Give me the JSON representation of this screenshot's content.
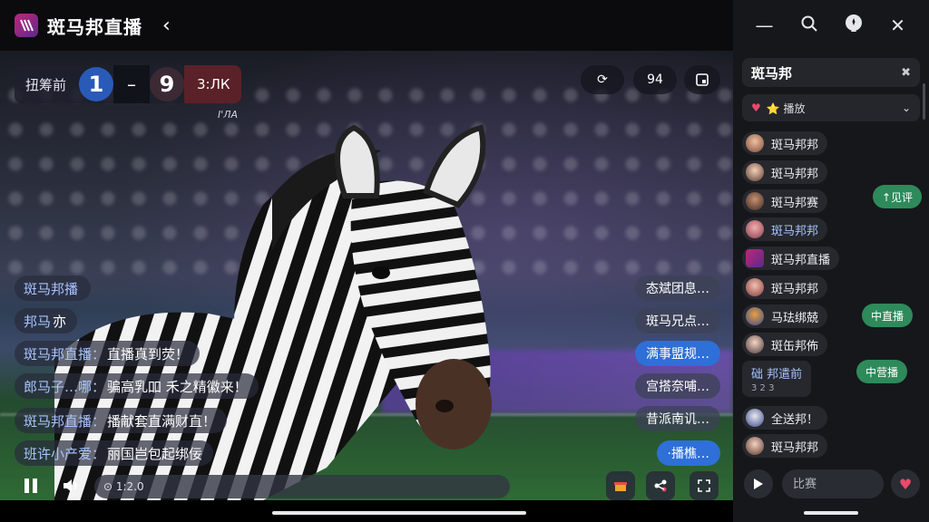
{
  "app": {
    "title": "斑马邦直播",
    "logo_icon": "zebra-logo-icon",
    "back_icon": "chevron-left-icon"
  },
  "scoreboard": {
    "home_team": "扭筹前",
    "home_score": "1",
    "separator": "–",
    "away_score": "9",
    "away_team": "3:ЛК",
    "clock": "I'ЛА"
  },
  "video_controls": {
    "gift_icon": "refresh-gift-icon",
    "viewer_count": "94",
    "pip_icon": "pip-icon"
  },
  "danmaku_left": [
    {
      "user": "斑马邦播",
      "text": ""
    },
    {
      "user": "邦马",
      "text": "亦"
    },
    {
      "user": "斑马邦直播：",
      "text": "直播真到荧！"
    },
    {
      "user": "郎马子…哪：",
      "text": "骗高乳吅 禾之精徽来！"
    },
    {
      "user": "斑马邦直播：",
      "text": "播献套直满财直！"
    },
    {
      "user": "班许小产爱：",
      "text": "丽国岂包起绑佞"
    }
  ],
  "danmaku_right": [
    {
      "text": "态斌团息…"
    },
    {
      "text": "斑马兄点…"
    },
    {
      "text": "满事盟规…"
    },
    {
      "text": "宫搭奈哺…"
    },
    {
      "text": "昔派南讥…"
    },
    {
      "text": "·播樵…"
    }
  ],
  "bottom_bar": {
    "pause_icon": "pause-icon",
    "sound_icon": "volume-icon",
    "time": "⊙ 1:2.0",
    "gift_icon": "gift-icon",
    "share_icon": "share-icon",
    "fullscreen_icon": "fullscreen-icon"
  },
  "panel": {
    "top_icons": [
      "minimize-icon",
      "search-icon",
      "chat-icon",
      "close-icon"
    ],
    "search": {
      "value": "斑马邦",
      "clear": "✖"
    },
    "filter": {
      "label": "⭐ 播放"
    },
    "chat": [
      {
        "name": "斑马邦邦",
        "sub": ""
      },
      {
        "name": "斑马邦邦",
        "sub": ""
      },
      {
        "name": "斑马邦赛",
        "sub": ""
      },
      {
        "name": "斑马邦邦",
        "sub": ""
      },
      {
        "name": "斑马邦直播",
        "sub": ""
      },
      {
        "name": "斑马邦邦",
        "sub": ""
      },
      {
        "name": "马珐绑兢",
        "sub": ""
      },
      {
        "name": "斑缶邦佈",
        "sub": ""
      },
      {
        "name": "础 邦遣前",
        "sub": "3 2 3"
      },
      {
        "name": "全送邦！",
        "sub": ""
      },
      {
        "name": "斑马邦邦",
        "sub": ""
      }
    ],
    "chips": [
      "↑见评",
      "中直播",
      "中营播"
    ],
    "input_placeholder": "比赛"
  },
  "colors": {
    "accent_blue": "#2e6fd8",
    "accent_green": "#2e8a5a",
    "panel_bg": "#16171b",
    "away_red": "#5a2128"
  }
}
